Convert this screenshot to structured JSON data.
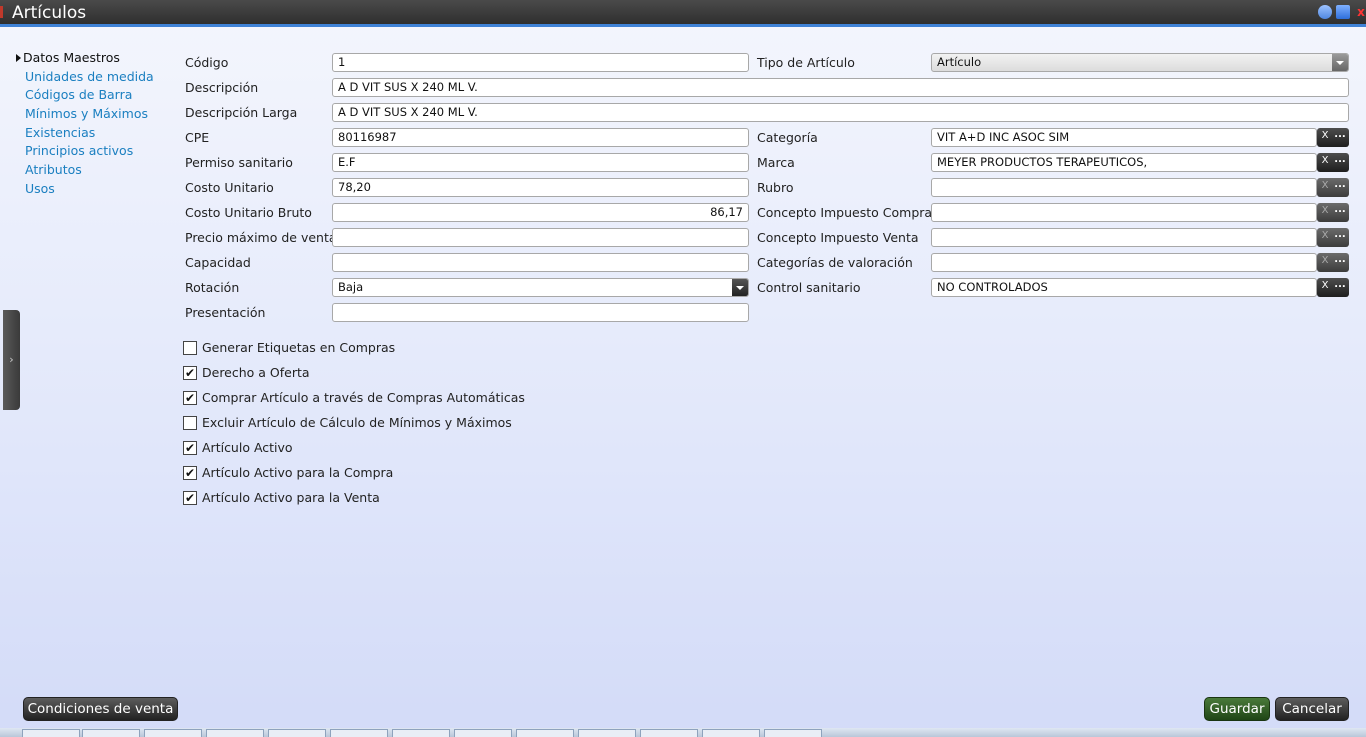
{
  "window": {
    "title": "Artículos",
    "controls": [
      "minimize",
      "maximize",
      "close"
    ],
    "close_glyph": "x"
  },
  "side_tab": {
    "glyph": "›"
  },
  "nav": {
    "items": [
      {
        "label": "Datos Maestros",
        "active": true
      },
      {
        "label": "Unidades de medida"
      },
      {
        "label": "Códigos de Barra"
      },
      {
        "label": "Mínimos y Máximos"
      },
      {
        "label": "Existencias"
      },
      {
        "label": "Principios activos"
      },
      {
        "label": "Atributos"
      },
      {
        "label": "Usos"
      }
    ]
  },
  "form": {
    "codigo": {
      "label": "Código",
      "value": "1"
    },
    "tipo_articulo": {
      "label": "Tipo de Artículo",
      "value": "Artículo"
    },
    "descripcion": {
      "label": "Descripción",
      "value": "A  D  VIT  SUS X 240  ML V."
    },
    "descripcion_larga": {
      "label": "Descripción Larga",
      "value": "A  D  VIT  SUS X 240  ML V."
    },
    "cpe": {
      "label": "CPE",
      "value": "80116987"
    },
    "categoria": {
      "label": "Categoría",
      "value": "VIT A+D INC ASOC SIM"
    },
    "permiso_sanitario": {
      "label": "Permiso sanitario",
      "value": "E.F"
    },
    "marca": {
      "label": "Marca",
      "value": "MEYER PRODUCTOS TERAPEUTICOS,"
    },
    "costo_unitario": {
      "label": "Costo Unitario",
      "value": "78,20"
    },
    "rubro": {
      "label": "Rubro",
      "value": ""
    },
    "costo_unitario_bruto": {
      "label": "Costo Unitario Bruto",
      "value": "86,17"
    },
    "concepto_impuesto_compra": {
      "label": "Concepto Impuesto Compra",
      "value": ""
    },
    "precio_maximo_venta": {
      "label": "Precio máximo de venta",
      "value": ""
    },
    "concepto_impuesto_venta": {
      "label": "Concepto Impuesto Venta",
      "value": ""
    },
    "capacidad": {
      "label": "Capacidad",
      "value": ""
    },
    "categorias_valoracion": {
      "label": "Categorías de valoración",
      "value": ""
    },
    "rotacion": {
      "label": "Rotación",
      "value": "Baja"
    },
    "control_sanitario": {
      "label": "Control sanitario",
      "value": "NO CONTROLADOS"
    },
    "presentacion": {
      "label": "Presentación",
      "value": ""
    },
    "lookup_clear_glyph": "X",
    "lookup_search_glyph": "..."
  },
  "checkboxes": [
    {
      "label": "Generar Etiquetas en Compras",
      "checked": false
    },
    {
      "label": "Derecho a Oferta",
      "checked": true
    },
    {
      "label": "Comprar Artículo a través de Compras Automáticas",
      "checked": true
    },
    {
      "label": "Excluir Artículo de Cálculo de Mínimos y Máximos",
      "checked": false
    },
    {
      "label": "Artículo Activo",
      "checked": true
    },
    {
      "label": "Artículo Activo para la Compra",
      "checked": true
    },
    {
      "label": "Artículo Activo para la Venta",
      "checked": true
    }
  ],
  "check_glyph": "✔",
  "buttons": {
    "condiciones_venta": "Condiciones de venta",
    "guardar": "Guardar",
    "cancelar": "Cancelar"
  },
  "colors": {
    "title_bar": "#3a3a3a",
    "accent": "#3f82d6",
    "link": "#1a7fc0",
    "save_button": "#2f5a24"
  }
}
